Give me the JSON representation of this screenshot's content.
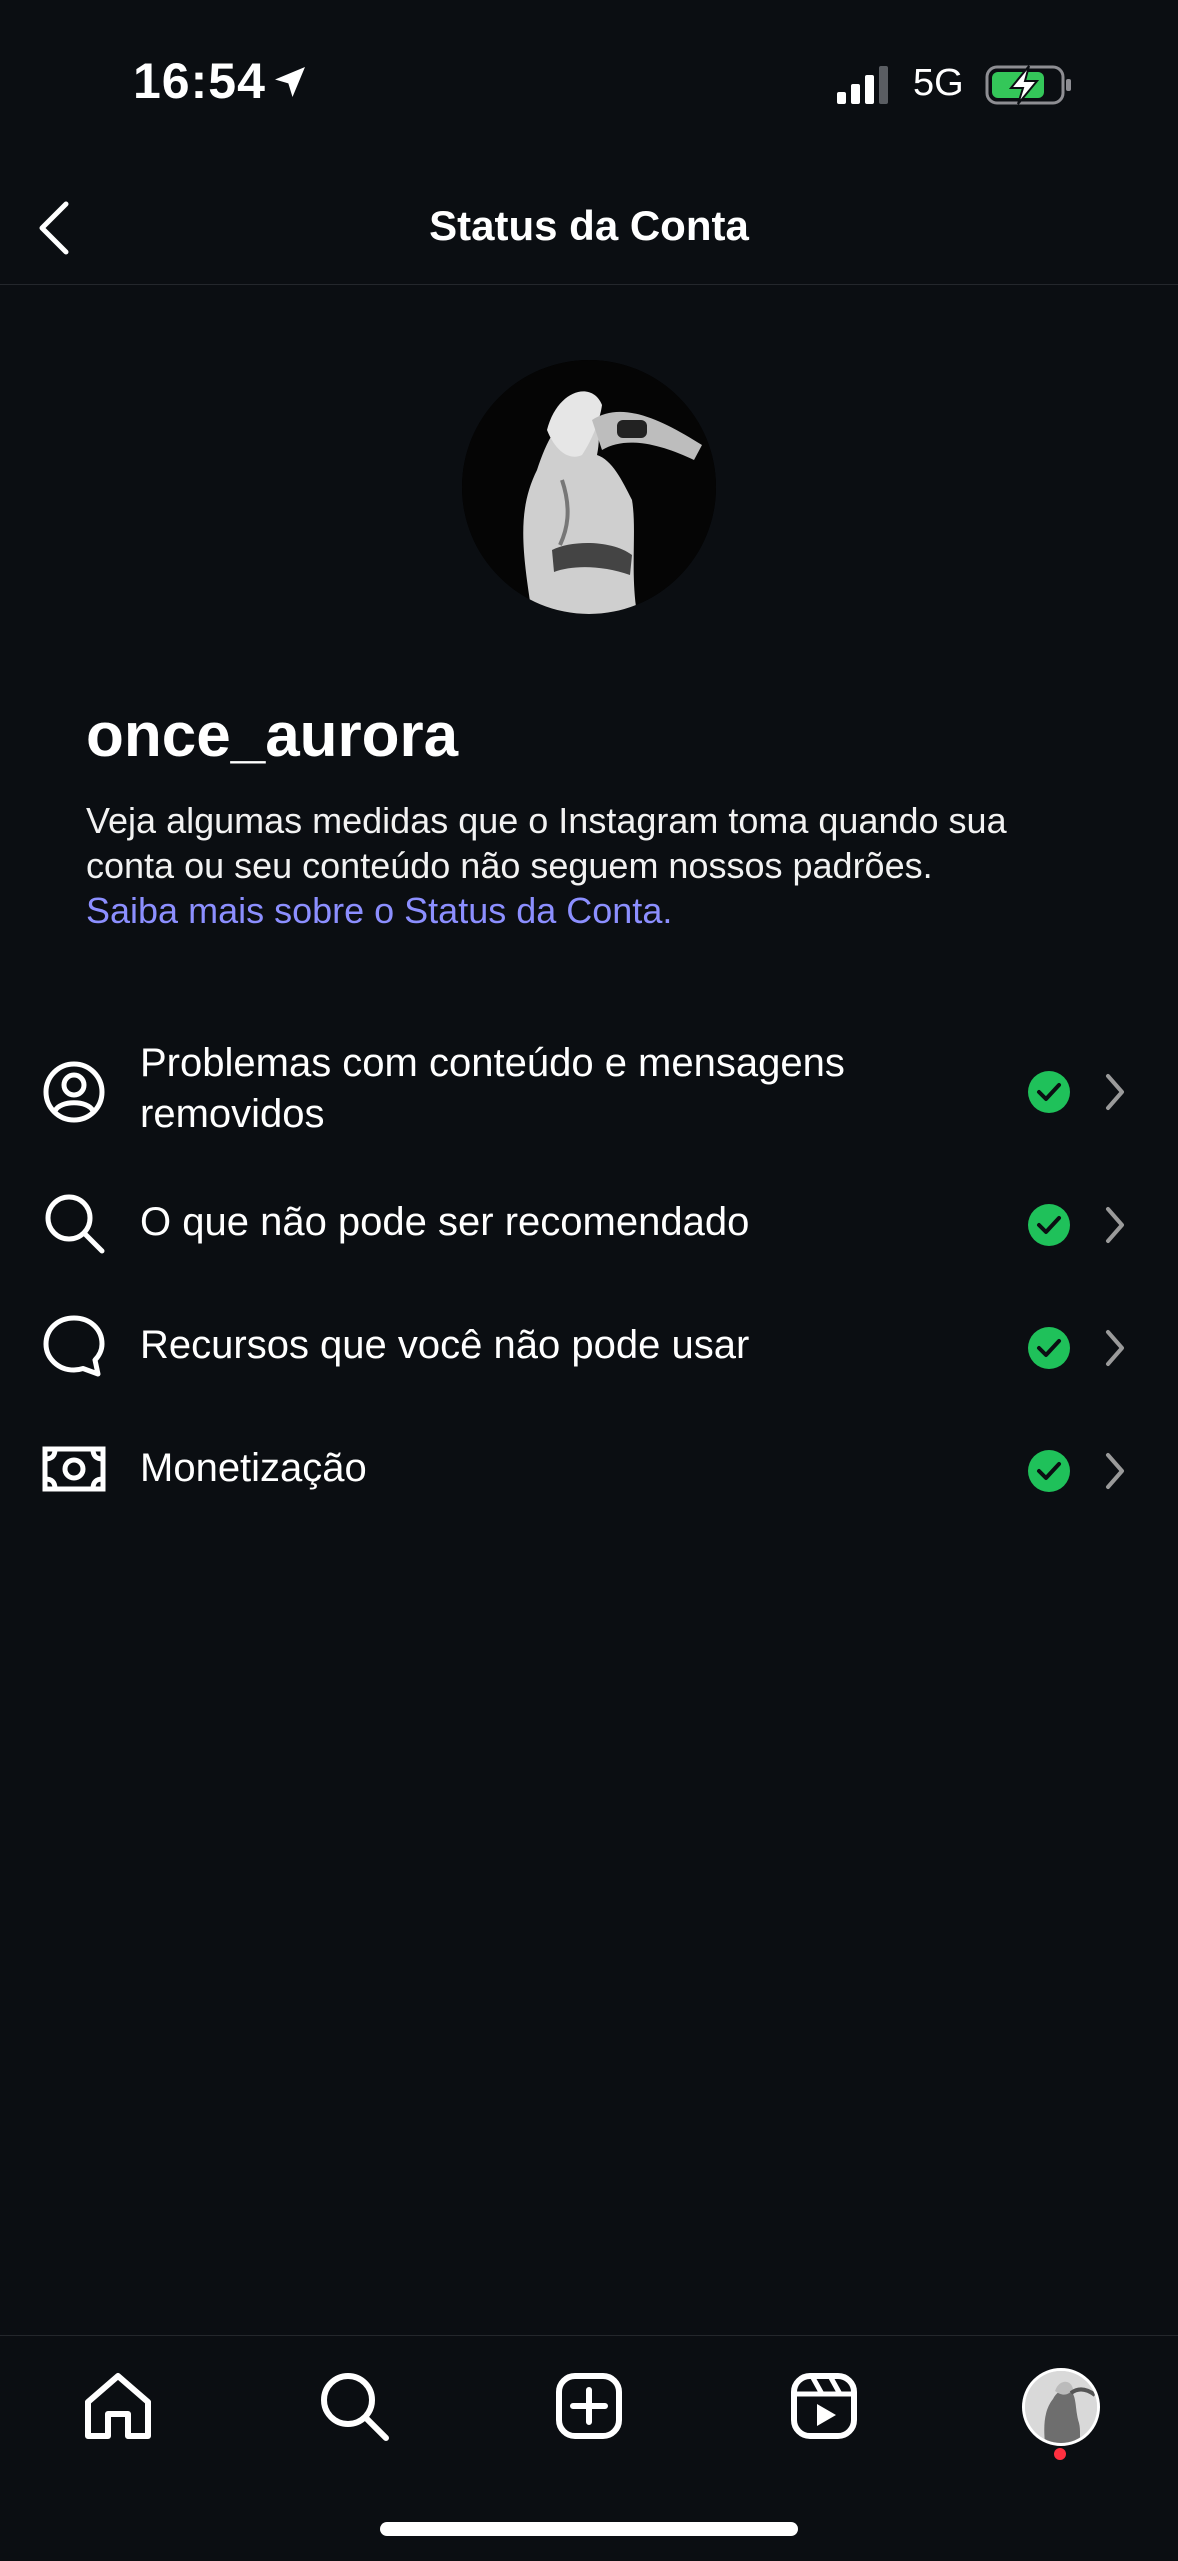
{
  "status_bar": {
    "time": "16:54",
    "network": "5G"
  },
  "header": {
    "title": "Status da Conta"
  },
  "profile": {
    "username": "once_aurora",
    "description": "Veja algumas medidas que o Instagram toma quando sua conta ou seu conteúdo não seguem nossos padrões.",
    "learn_more": "Saiba mais sobre o Status da Conta."
  },
  "items": [
    {
      "label": "Problemas com conteúdo e mensagens removidos",
      "icon": "person-circle-icon",
      "status": "ok"
    },
    {
      "label": "O que não pode ser recomendado",
      "icon": "search-icon",
      "status": "ok"
    },
    {
      "label": "Recursos que você não pode usar",
      "icon": "chat-bubble-icon",
      "status": "ok"
    },
    {
      "label": "Monetização",
      "icon": "money-icon",
      "status": "ok"
    }
  ],
  "nav": [
    "home-icon",
    "search-icon",
    "create-icon",
    "reels-icon",
    "profile-avatar"
  ],
  "colors": {
    "background": "#0b0e12",
    "link": "#8c8fff",
    "check": "#1fc15a",
    "battery_fill": "#34c759",
    "notification": "#ff3040"
  }
}
